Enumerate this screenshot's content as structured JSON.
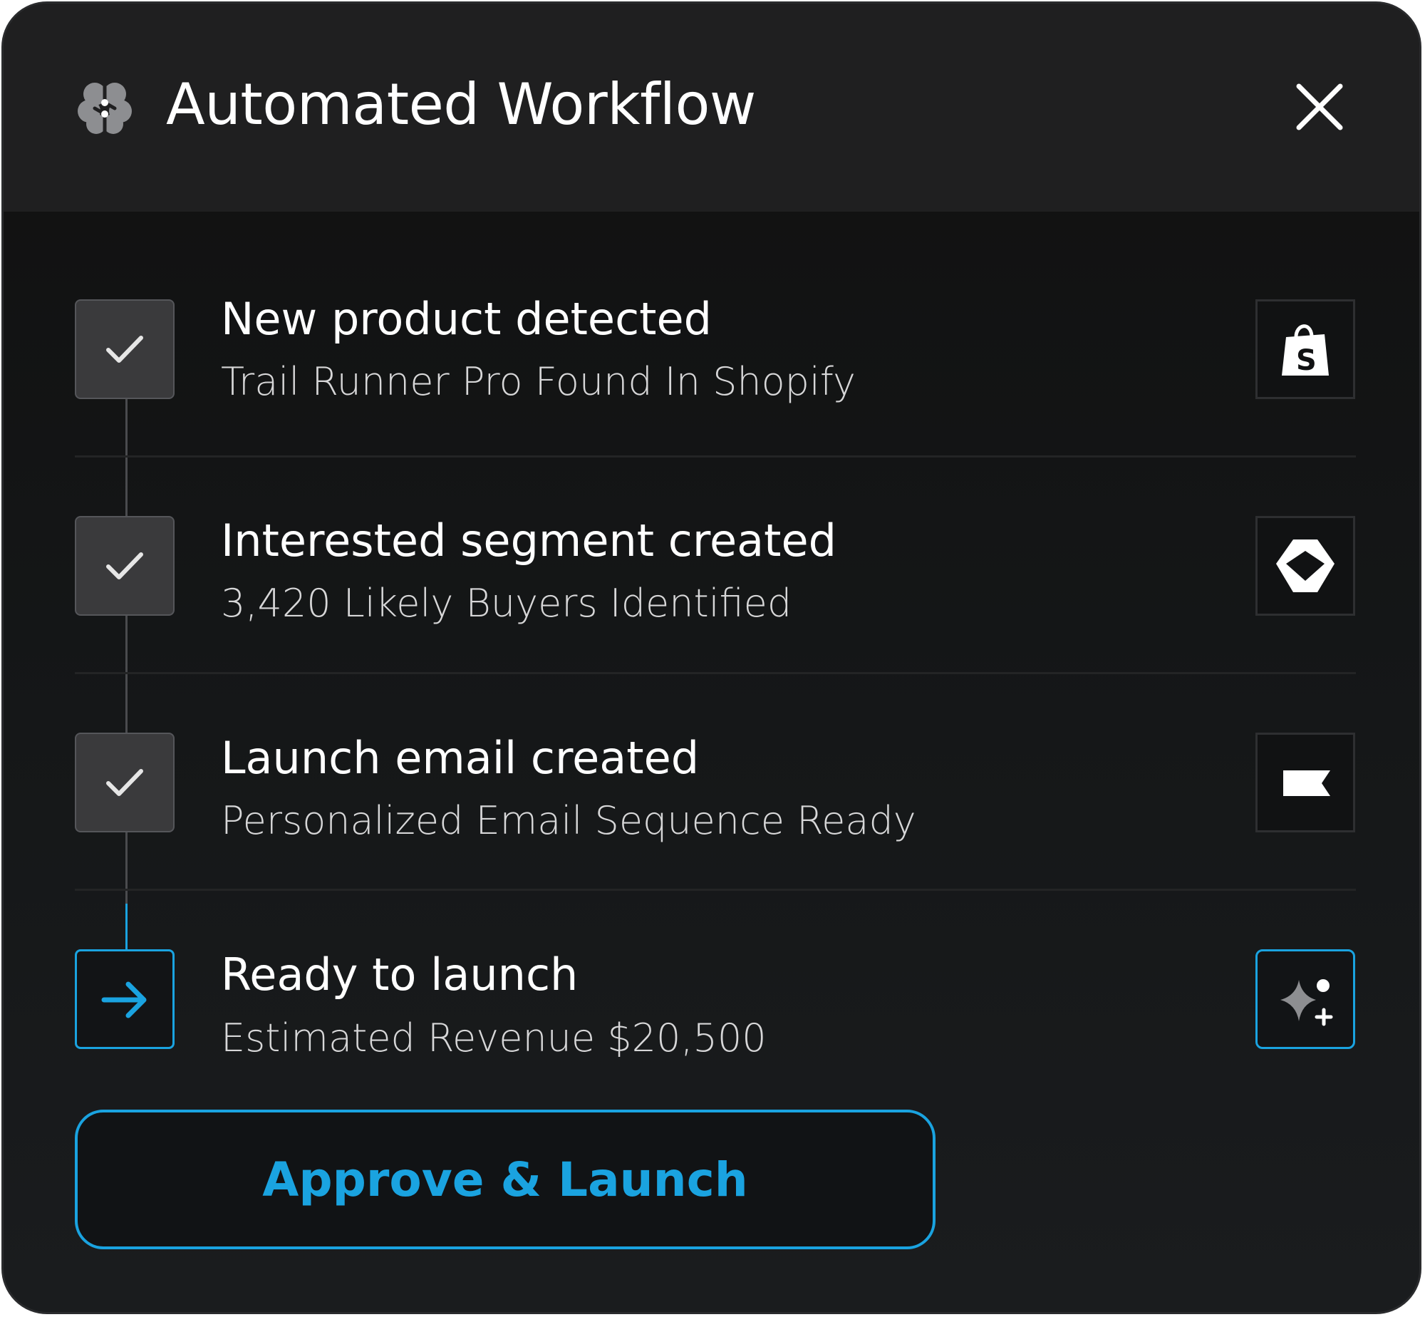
{
  "header": {
    "title": "Automated Workflow",
    "logo_icon": "brain-icon",
    "close_icon": "close-icon"
  },
  "steps": [
    {
      "title": "New product detected",
      "subtitle": "Trail Runner Pro Found In Shopify",
      "status": "done",
      "status_icon": "check-icon",
      "app_icon": "shopify-bag-icon"
    },
    {
      "title": "Interested segment created",
      "subtitle": "3,420 Likely Buyers Identified",
      "status": "done",
      "status_icon": "check-icon",
      "app_icon": "segment-logo-icon"
    },
    {
      "title": "Launch email created",
      "subtitle": "Personalized Email Sequence Ready",
      "status": "done",
      "status_icon": "check-icon",
      "app_icon": "klaviyo-flag-icon"
    },
    {
      "title": "Ready to launch",
      "subtitle": "Estimated Revenue $20,500",
      "status": "active",
      "status_icon": "arrow-right-icon",
      "app_icon": "ai-sparkle-icon"
    }
  ],
  "cta": {
    "label": "Approve & Launch"
  },
  "colors": {
    "accent": "#1aa3e0",
    "background": "#131516",
    "header_background": "#1f1f20",
    "done_box": "#3a3a3c"
  }
}
